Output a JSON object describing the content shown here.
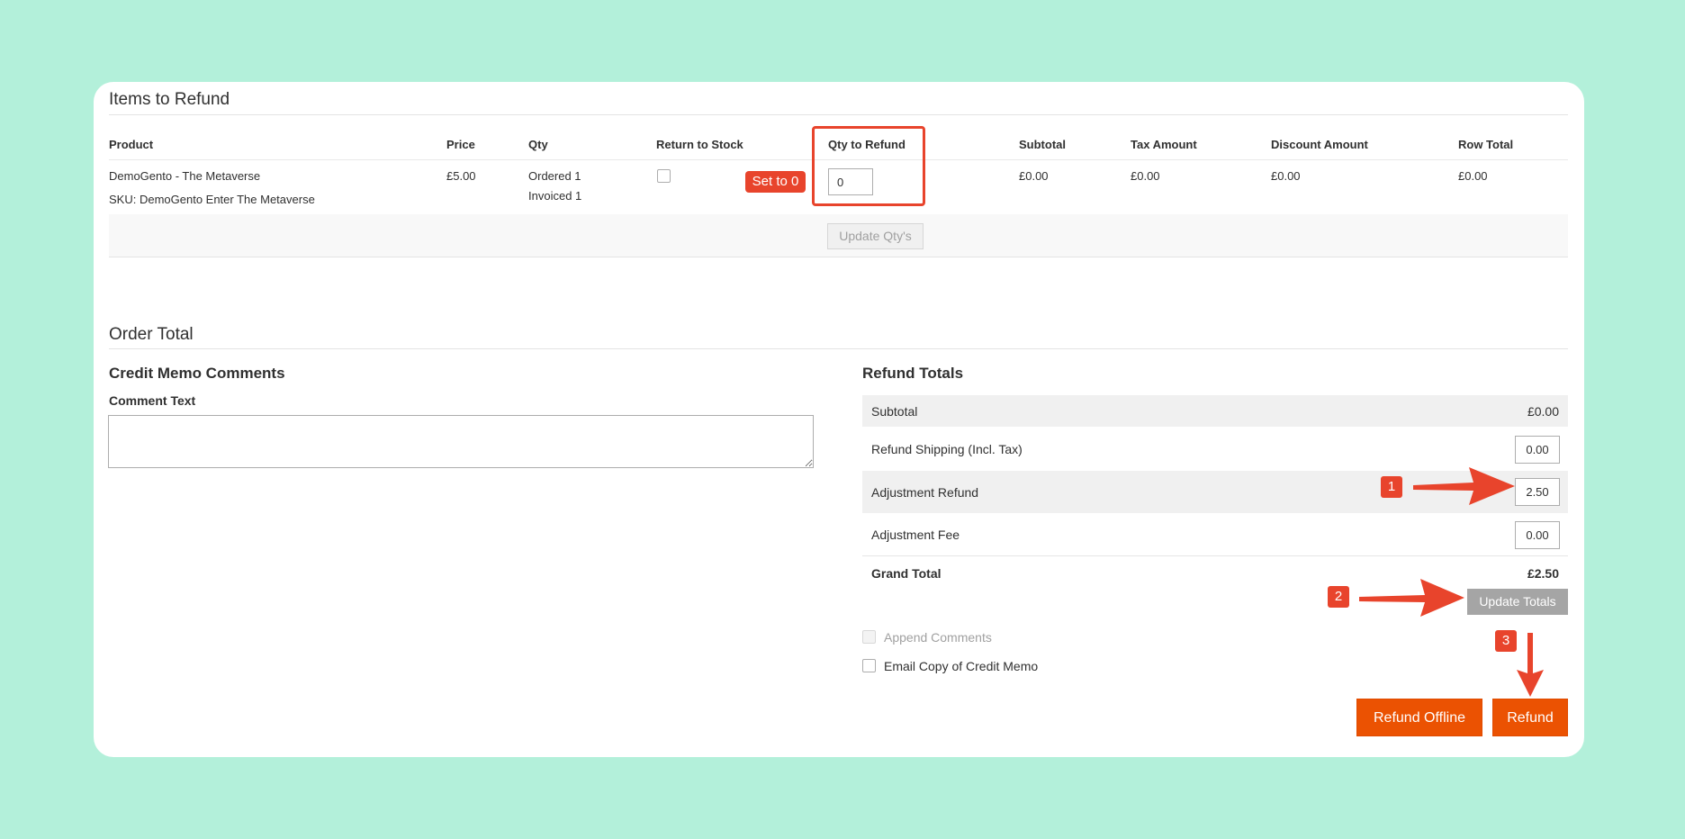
{
  "items_section": {
    "title": "Items to Refund",
    "columns": [
      "Product",
      "Price",
      "Qty",
      "Return to Stock",
      "Qty to Refund",
      "Subtotal",
      "Tax Amount",
      "Discount Amount",
      "Row Total"
    ],
    "row": {
      "product_name": "DemoGento - The Metaverse",
      "sku": "SKU: DemoGento Enter The Metaverse",
      "price": "£5.00",
      "qty_ordered": "Ordered 1",
      "qty_invoiced": "Invoiced 1",
      "qty_to_refund": "0",
      "subtotal": "£0.00",
      "tax_amount": "£0.00",
      "discount_amount": "£0.00",
      "row_total": "£0.00"
    },
    "set_to_zero_tag": "Set to 0",
    "update_qty_button": "Update Qty's"
  },
  "order_total": {
    "title": "Order Total",
    "comments": {
      "title": "Credit Memo Comments",
      "comment_label": "Comment Text"
    },
    "refund_totals": {
      "title": "Refund Totals",
      "subtotal_label": "Subtotal",
      "subtotal_value": "£0.00",
      "shipping_label": "Refund Shipping (Incl. Tax)",
      "shipping_value": "0.00",
      "adjustment_refund_label": "Adjustment Refund",
      "adjustment_refund_value": "2.50",
      "adjustment_fee_label": "Adjustment Fee",
      "adjustment_fee_value": "0.00",
      "grand_total_label": "Grand Total",
      "grand_total_value": "£2.50",
      "update_totals_button": "Update Totals"
    },
    "append_comments_label": "Append Comments",
    "email_copy_label": "Email Copy of Credit Memo",
    "refund_offline_button": "Refund Offline",
    "refund_button": "Refund"
  },
  "annotations": {
    "badge_1": "1",
    "badge_2": "2",
    "badge_3": "3",
    "color": "#e8442c"
  }
}
